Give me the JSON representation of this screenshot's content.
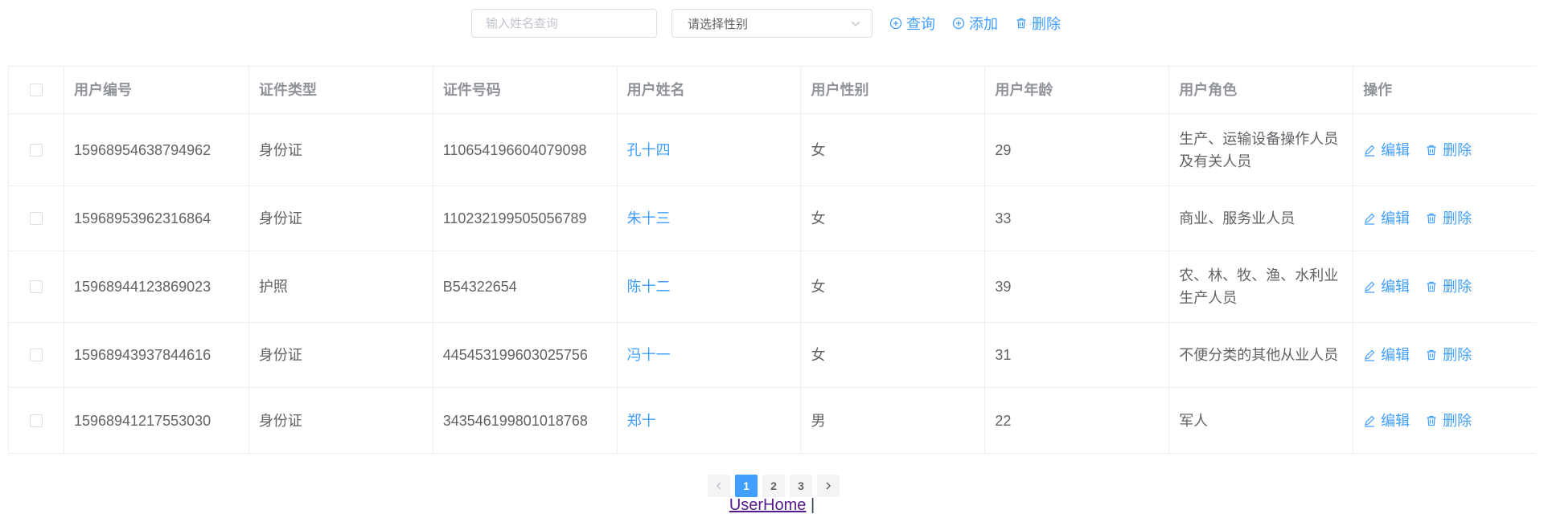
{
  "toolbar": {
    "search_placeholder": "输入姓名查询",
    "gender_select_placeholder": "请选择性别",
    "query_label": "查询",
    "add_label": "添加",
    "delete_label": "删除"
  },
  "table": {
    "columns": [
      "用户编号",
      "证件类型",
      "证件号码",
      "用户姓名",
      "用户性别",
      "用户年龄",
      "用户角色",
      "操作"
    ],
    "rows": [
      {
        "id": "15968954638794962",
        "id_type": "身份证",
        "id_number": "110654196604079098",
        "name": "孔十四",
        "gender": "女",
        "age": "29",
        "role": "生产、运输设备操作人员及有关人员"
      },
      {
        "id": "15968953962316864",
        "id_type": "身份证",
        "id_number": "110232199505056789",
        "name": "朱十三",
        "gender": "女",
        "age": "33",
        "role": "商业、服务业人员"
      },
      {
        "id": "15968944123869023",
        "id_type": "护照",
        "id_number": "B54322654",
        "name": "陈十二",
        "gender": "女",
        "age": "39",
        "role": "农、林、牧、渔、水利业生产人员"
      },
      {
        "id": "15968943937844616",
        "id_type": "身份证",
        "id_number": "445453199603025756",
        "name": "冯十一",
        "gender": "女",
        "age": "31",
        "role": "不便分类的其他从业人员"
      },
      {
        "id": "15968941217553030",
        "id_type": "身份证",
        "id_number": "343546199801018768",
        "name": "郑十",
        "gender": "男",
        "age": "22",
        "role": "军人"
      }
    ],
    "edit_label": "编辑",
    "delete_label": "删除"
  },
  "pagination": {
    "pages": [
      "1",
      "2",
      "3"
    ],
    "current": "1"
  },
  "footer": {
    "link_text": "UserHome",
    "separator": "|"
  },
  "colors": {
    "primary": "#409eff",
    "text": "#606266",
    "header_text": "#909399",
    "border": "#ebeef5"
  }
}
